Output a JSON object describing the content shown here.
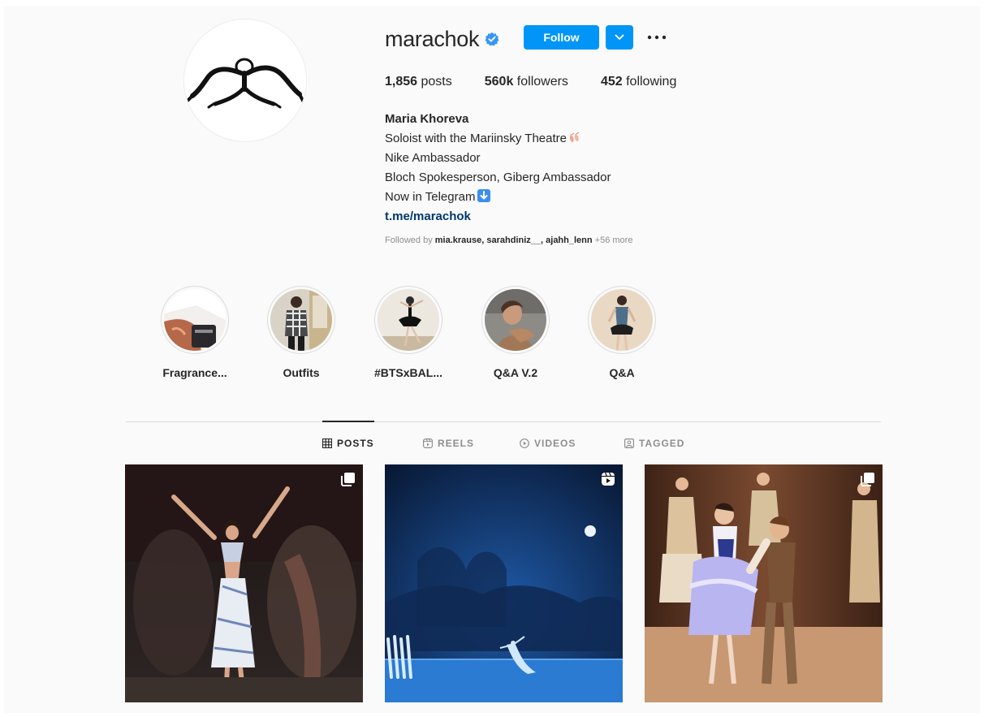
{
  "profile": {
    "username": "marachok",
    "follow_label": "Follow",
    "stats": {
      "posts_count": "1,856",
      "posts_label": "posts",
      "followers_count": "560k",
      "followers_label": "followers",
      "following_count": "452",
      "following_label": "following"
    },
    "bio": {
      "name": "Maria Khoreva",
      "line1": "Soloist with the Mariinsky Theatre",
      "line2": "Nike Ambassador",
      "line3": "Bloch Spokesperson, Giberg Ambassador",
      "line4": "Now in Telegram",
      "link": "t.me/marachok"
    },
    "followed_by": {
      "prefix": "Followed by",
      "names": [
        "mia.krause",
        "sarahdiniz__",
        "ajahh_lenn"
      ],
      "separator": ",",
      "more": "+56 more"
    }
  },
  "highlights": [
    {
      "label": "Fragrance..."
    },
    {
      "label": "Outfits"
    },
    {
      "label": "#BTSxBAL..."
    },
    {
      "label": "Q&A V.2"
    },
    {
      "label": "Q&A"
    }
  ],
  "tabs": [
    {
      "label": "POSTS",
      "icon": "grid-icon"
    },
    {
      "label": "REELS",
      "icon": "reels-icon"
    },
    {
      "label": "VIDEOS",
      "icon": "video-icon"
    },
    {
      "label": "TAGGED",
      "icon": "tagged-icon"
    }
  ],
  "posts": [
    {
      "badge": "carousel-icon"
    },
    {
      "badge": "reel-icon"
    },
    {
      "badge": "carousel-icon"
    }
  ],
  "colors": {
    "accent": "#0095f6",
    "link": "#00376b",
    "text": "#262626",
    "muted": "#8e8e8e",
    "border": "#dbdbdb",
    "background": "#fafafa"
  }
}
